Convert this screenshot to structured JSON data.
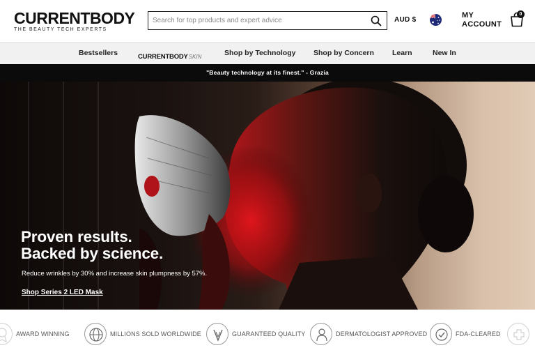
{
  "header": {
    "logo": "CURRENTBODY",
    "tagline": "THE BEAUTY TECH EXPERTS",
    "search_placeholder": "Search for top products and expert advice",
    "currency": "AUD $",
    "account_line1": "MY",
    "account_line2": "ACCOUNT",
    "cart_count": "0"
  },
  "nav": {
    "items": [
      "Bestsellers",
      "Shop by Technology",
      "Shop by Concern",
      "Learn",
      "New In"
    ],
    "brand_main": "CURRENTBODY",
    "brand_sub": "SKIN"
  },
  "announcement": "\"Beauty technology at its finest.\" - Grazia",
  "hero": {
    "title_line1": "Proven results.",
    "title_line2": "Backed by science.",
    "subtitle": "Reduce wrinkles by 30% and increase skin plumpness by 57%.",
    "cta": "Shop Series 2 LED Mask"
  },
  "trust": {
    "items": [
      "AWARD WINNING",
      "MILLIONS SOLD WORLDWIDE",
      "GUARANTEED QUALITY",
      "DERMATOLOGIST APPROVED",
      "FDA-CLEARED"
    ]
  },
  "colors": {
    "announcement_bg": "#0b0b0b",
    "nav_bg": "#f1f1f1",
    "hero_red": "#c8141a"
  }
}
